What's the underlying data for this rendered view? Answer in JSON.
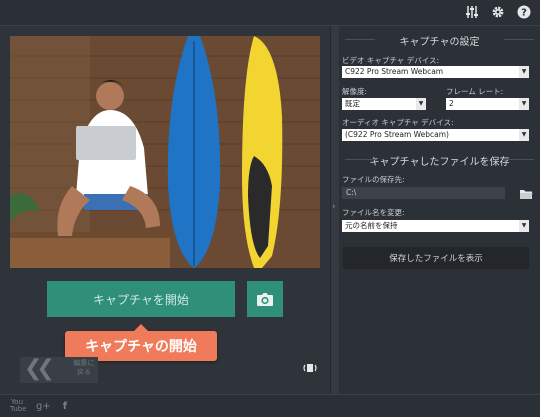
{
  "left_panel": {
    "start_capture_label": "キャプチャを開始",
    "callout_label": "キャプチャの開始",
    "back_label_line1": "編集に",
    "back_label_line2": "戻る"
  },
  "settings": {
    "capture_settings_title": "キャプチャの設定",
    "video_device_label": "ビデオ キャプチャ デバイス:",
    "video_device_value": "C922 Pro Stream Webcam",
    "resolution_label": "解像度:",
    "resolution_value": "既定",
    "framerate_label": "フレーム レート:",
    "framerate_value": "2",
    "audio_device_label": "オーディオ キャプチャ デバイス:",
    "audio_device_value": "(C922 Pro Stream Webcam)",
    "save_title": "キャプチャしたファイルを保存",
    "save_location_label": "ファイルの保存先:",
    "save_location_value": "C:\\",
    "filename_label": "ファイル名を変更:",
    "filename_value": "元の名前を保持",
    "show_files_label": "保存したファイルを表示"
  },
  "social": {
    "youtube": "You Tube",
    "gplus": "g+",
    "facebook": "f"
  },
  "colors": {
    "accent": "#2f8f78",
    "callout": "#f07b5a",
    "background": "#2b3036"
  }
}
